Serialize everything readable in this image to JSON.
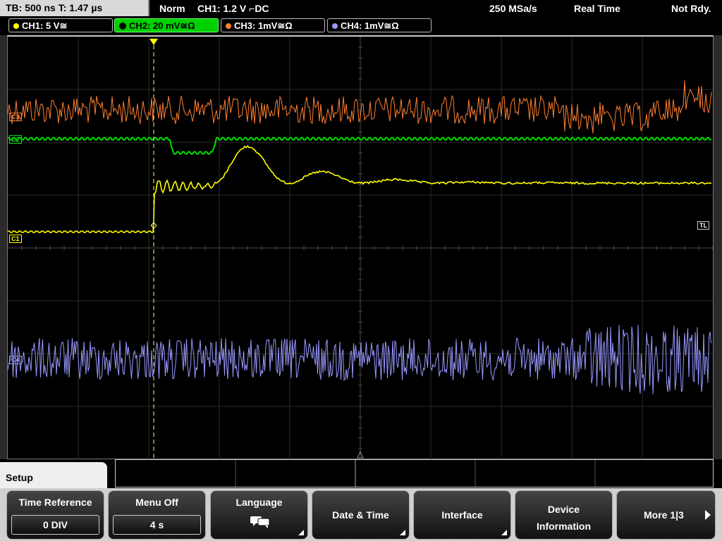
{
  "topbar": {
    "timebase": "TB: 500 ns   T: 1.47 µs",
    "mode": "Norm",
    "trigger": "CH1: 1.2 V ⌐DC",
    "sample_rate": "250 MSa/s",
    "acq_mode": "Real Time",
    "status": "Not Rdy."
  },
  "channels": [
    {
      "label": "CH1: 5 V≅",
      "color": "#ffff00"
    },
    {
      "label": "CH2: 20 mV≅Ω",
      "color": "#00e000"
    },
    {
      "label": "CH3: 1mV≅Ω",
      "color": "#ff8030"
    },
    {
      "label": "CH4: 1mV≅Ω",
      "color": "#9999ff"
    }
  ],
  "markers": {
    "ch3": "C3",
    "ch2": "C2",
    "ch1": "C1",
    "ch4": "C4",
    "trigger_level": "TL",
    "trigger_pos": "T"
  },
  "menu": {
    "title": "Setup",
    "buttons": [
      {
        "label": "Time Reference",
        "value": "0 DIV"
      },
      {
        "label": "Menu Off",
        "value": "4 s"
      },
      {
        "label": "Language",
        "icon": "speech-bubbles-icon"
      },
      {
        "label": "Date & Time"
      },
      {
        "label": "Interface"
      },
      {
        "label": "Device Information"
      },
      {
        "label": "More 1|3"
      }
    ]
  }
}
